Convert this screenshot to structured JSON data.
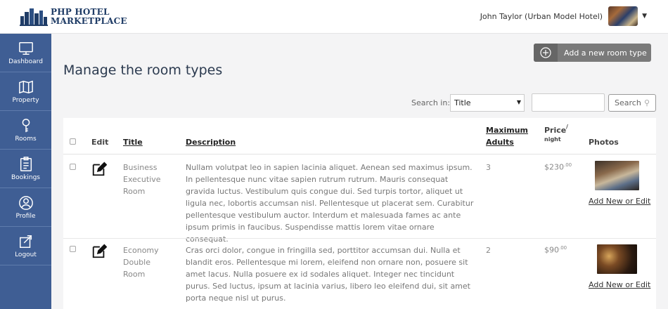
{
  "brand": {
    "line1": "PHP HOTEL",
    "line2": "MARKETPLACE"
  },
  "user": {
    "name": "John Taylor (Urban Model Hotel)"
  },
  "sidebar": {
    "items": [
      {
        "label": "Dashboard",
        "icon": "monitor-icon"
      },
      {
        "label": "Property",
        "icon": "map-icon"
      },
      {
        "label": "Rooms",
        "icon": "key-icon"
      },
      {
        "label": "Bookings",
        "icon": "clipboard-icon"
      },
      {
        "label": "Profile",
        "icon": "user-icon"
      },
      {
        "label": "Logout",
        "icon": "logout-icon"
      }
    ]
  },
  "main": {
    "add_button": "Add a new room type",
    "title": "Manage the room types",
    "search": {
      "label": "Search in:",
      "selected": "Title",
      "input_value": "",
      "button": "Search"
    }
  },
  "table": {
    "headers": {
      "edit": "Edit",
      "title": "Title",
      "description": "Description",
      "max_adults_1": "Maximum",
      "max_adults_2": "Adults",
      "price": "Price",
      "price_sep": "/",
      "price_unit": "night",
      "photos": "Photos"
    },
    "rows": [
      {
        "title_1": "Business",
        "title_2": "Executive",
        "title_3": "Room",
        "description": "Nullam volutpat leo in sapien lacinia aliquet. Aenean sed maximus ipsum. In pellentesque nunc vitae sapien rutrum rutrum. Mauris consequat gravida luctus. Vestibulum quis congue dui. Sed turpis tortor, aliquet ut ligula nec, lobortis accumsan nisl. Pellentesque ut placerat sem. Curabitur pellentesque vestibulum auctor. Interdum et malesuada fames ac ante ipsum primis in faucibus. Suspendisse mattis lorem vitae ornare consequat.",
        "max_adults": "3",
        "price_main": "$230",
        "price_cents": ".00",
        "photo_link": "Add New or Edit"
      },
      {
        "title_1": "Economy",
        "title_2": "Double",
        "title_3": "Room",
        "description": "Cras orci dolor, congue in fringilla sed, porttitor accumsan dui. Nulla et blandit eros. Pellentesque mi lorem, eleifend non ornare non, posuere sit amet lacus. Nulla posuere ex id sodales aliquet. Integer nec tincidunt purus. Sed luctus, ipsum at lacinia varius, libero leo eleifend dui, sit amet porta neque nisl ut purus.",
        "max_adults": "2",
        "price_main": "$90",
        "price_cents": ".00",
        "photo_link": "Add New or Edit"
      }
    ]
  },
  "colors": {
    "sidebar": "#3f5e94",
    "brand": "#1f3c66",
    "add_button": "#7a7a7a"
  }
}
